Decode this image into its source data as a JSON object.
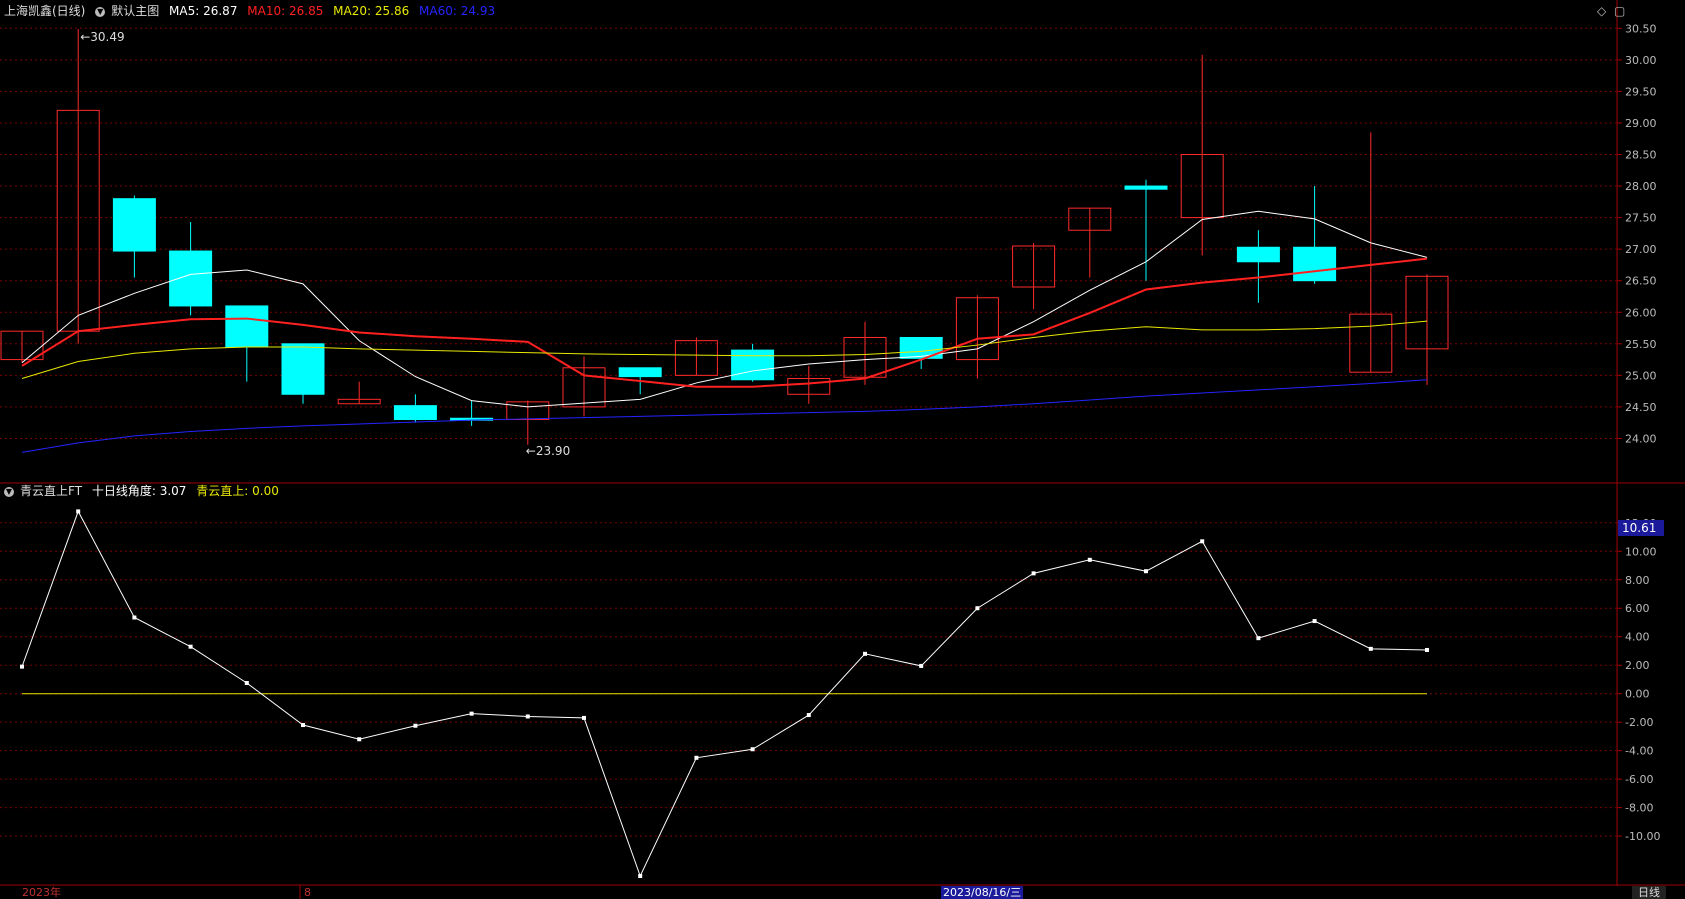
{
  "header": {
    "stock_title": "上海凯鑫(日线)",
    "template_name": "默认主图",
    "ma5": "MA5: 26.87",
    "ma10": "MA10: 26.85",
    "ma20": "MA20: 25.86",
    "ma60": "MA60: 24.93"
  },
  "indicator_header": {
    "name": "青云直上FT",
    "angle_label": "十日线角度: 3.07",
    "signal_label": "青云直上: 0.00"
  },
  "price_annotations": {
    "high": "30.49",
    "low": "23.90"
  },
  "indicator_current": "10.61",
  "bottom": {
    "year_label": "2023年",
    "month_label": "8",
    "cursor_date": "2023/08/16/三",
    "period_button": "日线"
  },
  "colors": {
    "up": "#ff2a2a",
    "down": "#00ffff",
    "ma5": "#ffffff",
    "ma10": "#ff2020",
    "ma20": "#e8e800",
    "ma60": "#2424ff",
    "grid": "#7a0000",
    "axis_text": "#bbbbbb"
  },
  "chart_data": [
    {
      "type": "candlestick",
      "title": "上海凯鑫(日线)",
      "ylim": [
        23.5,
        30.6
      ],
      "y_ticks": [
        24.0,
        24.5,
        25.0,
        25.5,
        26.0,
        26.5,
        27.0,
        27.5,
        28.0,
        28.5,
        29.0,
        29.5,
        30.0,
        30.5
      ],
      "candles": [
        {
          "o": 25.25,
          "h": 25.7,
          "l": 25.2,
          "c": 25.7
        },
        {
          "o": 25.7,
          "h": 30.49,
          "l": 25.5,
          "c": 29.2
        },
        {
          "o": 27.8,
          "h": 27.85,
          "l": 26.55,
          "c": 26.97
        },
        {
          "o": 26.97,
          "h": 27.43,
          "l": 25.95,
          "c": 26.1
        },
        {
          "o": 26.1,
          "h": 26.1,
          "l": 24.9,
          "c": 25.45
        },
        {
          "o": 25.5,
          "h": 25.5,
          "l": 24.55,
          "c": 24.7
        },
        {
          "o": 24.55,
          "h": 24.9,
          "l": 24.55,
          "c": 24.62
        },
        {
          "o": 24.52,
          "h": 24.7,
          "l": 24.25,
          "c": 24.3
        },
        {
          "o": 24.32,
          "h": 24.6,
          "l": 24.2,
          "c": 24.3
        },
        {
          "o": 24.3,
          "h": 24.6,
          "l": 23.9,
          "c": 24.58
        },
        {
          "o": 24.5,
          "h": 25.3,
          "l": 24.35,
          "c": 25.12
        },
        {
          "o": 25.12,
          "h": 25.12,
          "l": 24.7,
          "c": 24.98
        },
        {
          "o": 25.0,
          "h": 25.6,
          "l": 25.0,
          "c": 25.55
        },
        {
          "o": 25.4,
          "h": 25.5,
          "l": 24.9,
          "c": 24.93
        },
        {
          "o": 24.7,
          "h": 25.15,
          "l": 24.55,
          "c": 24.95
        },
        {
          "o": 24.97,
          "h": 25.85,
          "l": 24.85,
          "c": 25.6
        },
        {
          "o": 25.6,
          "h": 25.6,
          "l": 25.1,
          "c": 25.27
        },
        {
          "o": 25.25,
          "h": 26.27,
          "l": 24.95,
          "c": 26.23
        },
        {
          "o": 26.4,
          "h": 27.1,
          "l": 26.05,
          "c": 27.05
        },
        {
          "o": 27.3,
          "h": 27.65,
          "l": 26.55,
          "c": 27.65
        },
        {
          "o": 28.0,
          "h": 28.1,
          "l": 26.5,
          "c": 27.95
        },
        {
          "o": 27.5,
          "h": 30.08,
          "l": 26.9,
          "c": 28.5
        },
        {
          "o": 27.03,
          "h": 27.3,
          "l": 26.15,
          "c": 26.8
        },
        {
          "o": 27.03,
          "h": 28.0,
          "l": 26.45,
          "c": 26.5
        },
        {
          "o": 25.05,
          "h": 28.85,
          "l": 25.05,
          "c": 25.97
        },
        {
          "o": 25.42,
          "h": 26.6,
          "l": 24.85,
          "c": 26.57
        }
      ],
      "series": [
        {
          "name": "MA5",
          "values": [
            25.2,
            25.95,
            26.3,
            26.6,
            26.67,
            26.45,
            25.55,
            24.98,
            24.6,
            24.5,
            24.56,
            24.62,
            24.88,
            25.07,
            25.18,
            25.25,
            25.3,
            25.42,
            25.85,
            26.35,
            26.8,
            27.47,
            27.6,
            27.48,
            27.1,
            26.87
          ]
        },
        {
          "name": "MA10",
          "values": [
            25.15,
            25.7,
            25.8,
            25.89,
            25.9,
            25.8,
            25.68,
            25.62,
            25.58,
            25.53,
            25.0,
            24.91,
            24.82,
            24.82,
            24.87,
            24.95,
            25.25,
            25.58,
            25.65,
            25.99,
            26.36,
            26.47,
            26.55,
            26.65,
            26.75,
            26.85
          ]
        },
        {
          "name": "MA20",
          "values": [
            24.95,
            25.22,
            25.35,
            25.42,
            25.45,
            25.45,
            25.42,
            25.4,
            25.38,
            25.36,
            25.34,
            25.33,
            25.32,
            25.31,
            25.31,
            25.33,
            25.38,
            25.48,
            25.6,
            25.7,
            25.77,
            25.72,
            25.72,
            25.74,
            25.78,
            25.86
          ]
        },
        {
          "name": "MA60",
          "values": [
            23.78,
            23.93,
            24.04,
            24.11,
            24.16,
            24.2,
            24.23,
            24.26,
            24.29,
            24.31,
            24.33,
            24.35,
            24.37,
            24.39,
            24.41,
            24.43,
            24.46,
            24.5,
            24.55,
            24.61,
            24.67,
            24.72,
            24.77,
            24.82,
            24.87,
            24.93
          ]
        }
      ]
    },
    {
      "type": "line",
      "title": "青云直上FT",
      "ylim": [
        -12.8,
        13.6
      ],
      "y_ticks": [
        -10.0,
        -8.0,
        -6.0,
        -4.0,
        -2.0,
        0.0,
        2.0,
        4.0,
        6.0,
        8.0,
        10.0,
        12.0
      ],
      "series": [
        {
          "name": "十日线角度",
          "values": [
            1.9,
            12.8,
            5.35,
            3.3,
            0.75,
            -2.2,
            -3.2,
            -2.25,
            -1.4,
            -1.6,
            -1.7,
            -12.8,
            -4.5,
            -3.9,
            -1.5,
            2.8,
            1.95,
            6.0,
            8.45,
            9.4,
            8.6,
            10.7,
            3.9,
            5.1,
            3.15,
            3.07
          ]
        },
        {
          "name": "青云直上",
          "values": [
            0,
            0,
            0,
            0,
            0,
            0,
            0,
            0,
            0,
            0,
            0,
            0,
            0,
            0,
            0,
            0,
            0,
            0,
            0,
            0,
            0,
            0,
            0,
            0,
            0,
            0
          ]
        }
      ]
    }
  ]
}
